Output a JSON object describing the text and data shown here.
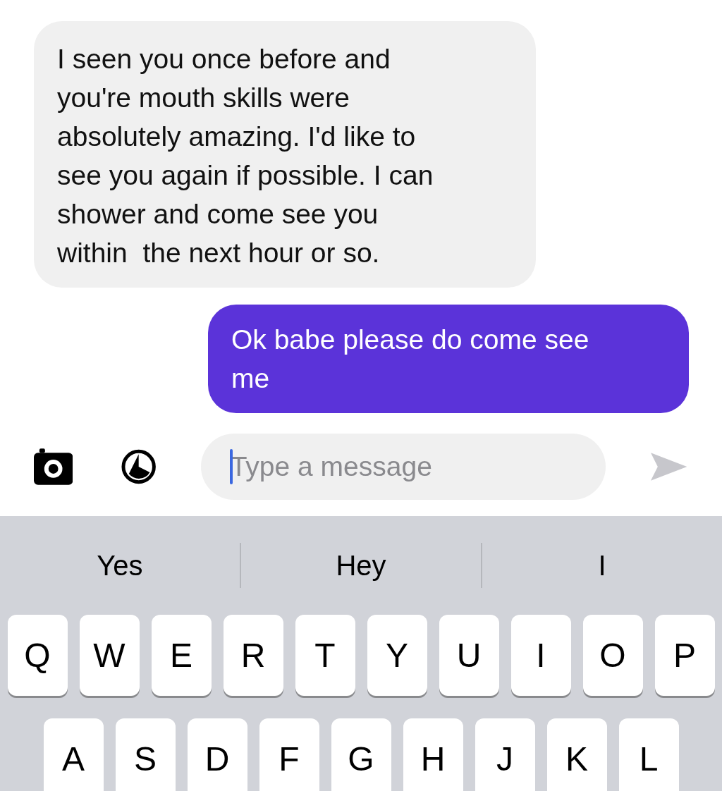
{
  "messages": [
    {
      "kind": "incoming",
      "text": "I seen you once before and\nyou're mouth skills were\nabsolutely amazing. I'd like to\nsee you again if possible. I can\nshower and come see you\nwithin  the next hour or so."
    },
    {
      "kind": "outgoing",
      "text": "Ok babe please do come see\nme"
    }
  ],
  "composer": {
    "placeholder": "Type a message"
  },
  "keyboard": {
    "suggestions": [
      "Yes",
      "Hey",
      "I"
    ],
    "rows": [
      [
        "Q",
        "W",
        "E",
        "R",
        "T",
        "Y",
        "U",
        "I",
        "O",
        "P"
      ],
      [
        "A",
        "S",
        "D",
        "F",
        "G",
        "H",
        "J",
        "K",
        "L"
      ]
    ]
  }
}
